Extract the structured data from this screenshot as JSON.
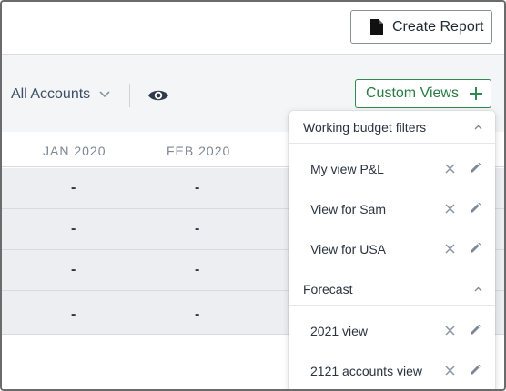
{
  "header": {
    "create_report_label": "Create Report",
    "create_report_icon": "document-icon"
  },
  "toolbar": {
    "accounts_label": "All Accounts",
    "accounts_icon": "chevron-down-icon",
    "visibility_icon": "eye-icon",
    "custom_views_label": "Custom Views",
    "custom_views_icon": "plus-icon",
    "accent_color": "#2e8a4e"
  },
  "table": {
    "columns": [
      "JAN 2020",
      "FEB 2020"
    ],
    "rows": [
      [
        "-",
        "-"
      ],
      [
        "-",
        "-"
      ],
      [
        "-",
        "-"
      ],
      [
        "-",
        "-"
      ]
    ]
  },
  "dropdown": {
    "sections": [
      {
        "title": "Working budget filters",
        "items": [
          "My view P&L",
          "View for Sam",
          "View for USA"
        ]
      },
      {
        "title": "Forecast",
        "items": [
          "2021 view",
          "2121 accounts view"
        ]
      }
    ]
  }
}
